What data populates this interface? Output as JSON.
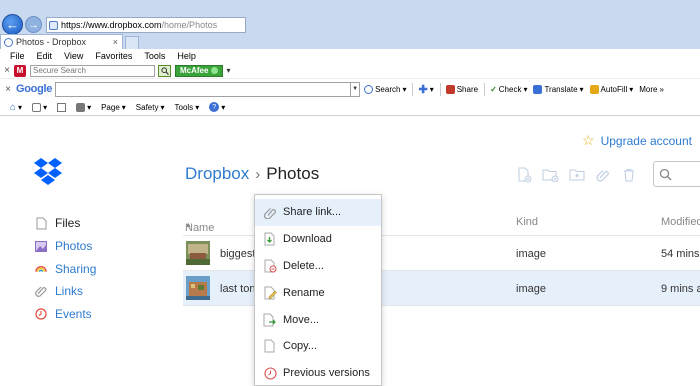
{
  "browser": {
    "url_host": "https://www.dropbox.com",
    "url_path": "/home/Photos",
    "tab_title": "Photos - Dropbox",
    "tab_close": "×",
    "menu": [
      "File",
      "Edit",
      "View",
      "Favorites",
      "Tools",
      "Help"
    ],
    "toolbar1": {
      "close": "×",
      "search_placeholder": "Secure Search",
      "mcafee_label": "McAfee"
    },
    "toolbar2": {
      "close": "×",
      "google_label": "Google",
      "items": [
        "Search",
        "Share",
        "Check",
        "Translate",
        "AutoFill",
        "More"
      ]
    },
    "toolbar3": {
      "items": [
        "Page",
        "Safety",
        "Tools"
      ]
    }
  },
  "header": {
    "upgrade_label": "Upgrade account"
  },
  "sidebar": {
    "items": [
      {
        "label": "Files"
      },
      {
        "label": "Photos"
      },
      {
        "label": "Sharing"
      },
      {
        "label": "Links"
      },
      {
        "label": "Events"
      }
    ]
  },
  "breadcrumb": {
    "root": "Dropbox",
    "separator": "›",
    "current": "Photos"
  },
  "table": {
    "columns": {
      "name": "Name",
      "sort_indicator": "▲",
      "kind": "Kind",
      "modified": "Modified"
    },
    "rows": [
      {
        "name": "biggest",
        "kind": "image",
        "modified": "54 mins"
      },
      {
        "name": "last ton",
        "kind": "image",
        "modified": "9 mins a"
      }
    ]
  },
  "context_menu": {
    "items": [
      {
        "label": "Share link..."
      },
      {
        "label": "Download"
      },
      {
        "label": "Delete..."
      },
      {
        "label": "Rename"
      },
      {
        "label": "Move..."
      },
      {
        "label": "Copy..."
      },
      {
        "label": "Previous versions"
      }
    ]
  },
  "colors": {
    "accent": "#2e7bcf",
    "selected_row": "#e6f0fb",
    "dropbox_blue": "#0061fe"
  }
}
